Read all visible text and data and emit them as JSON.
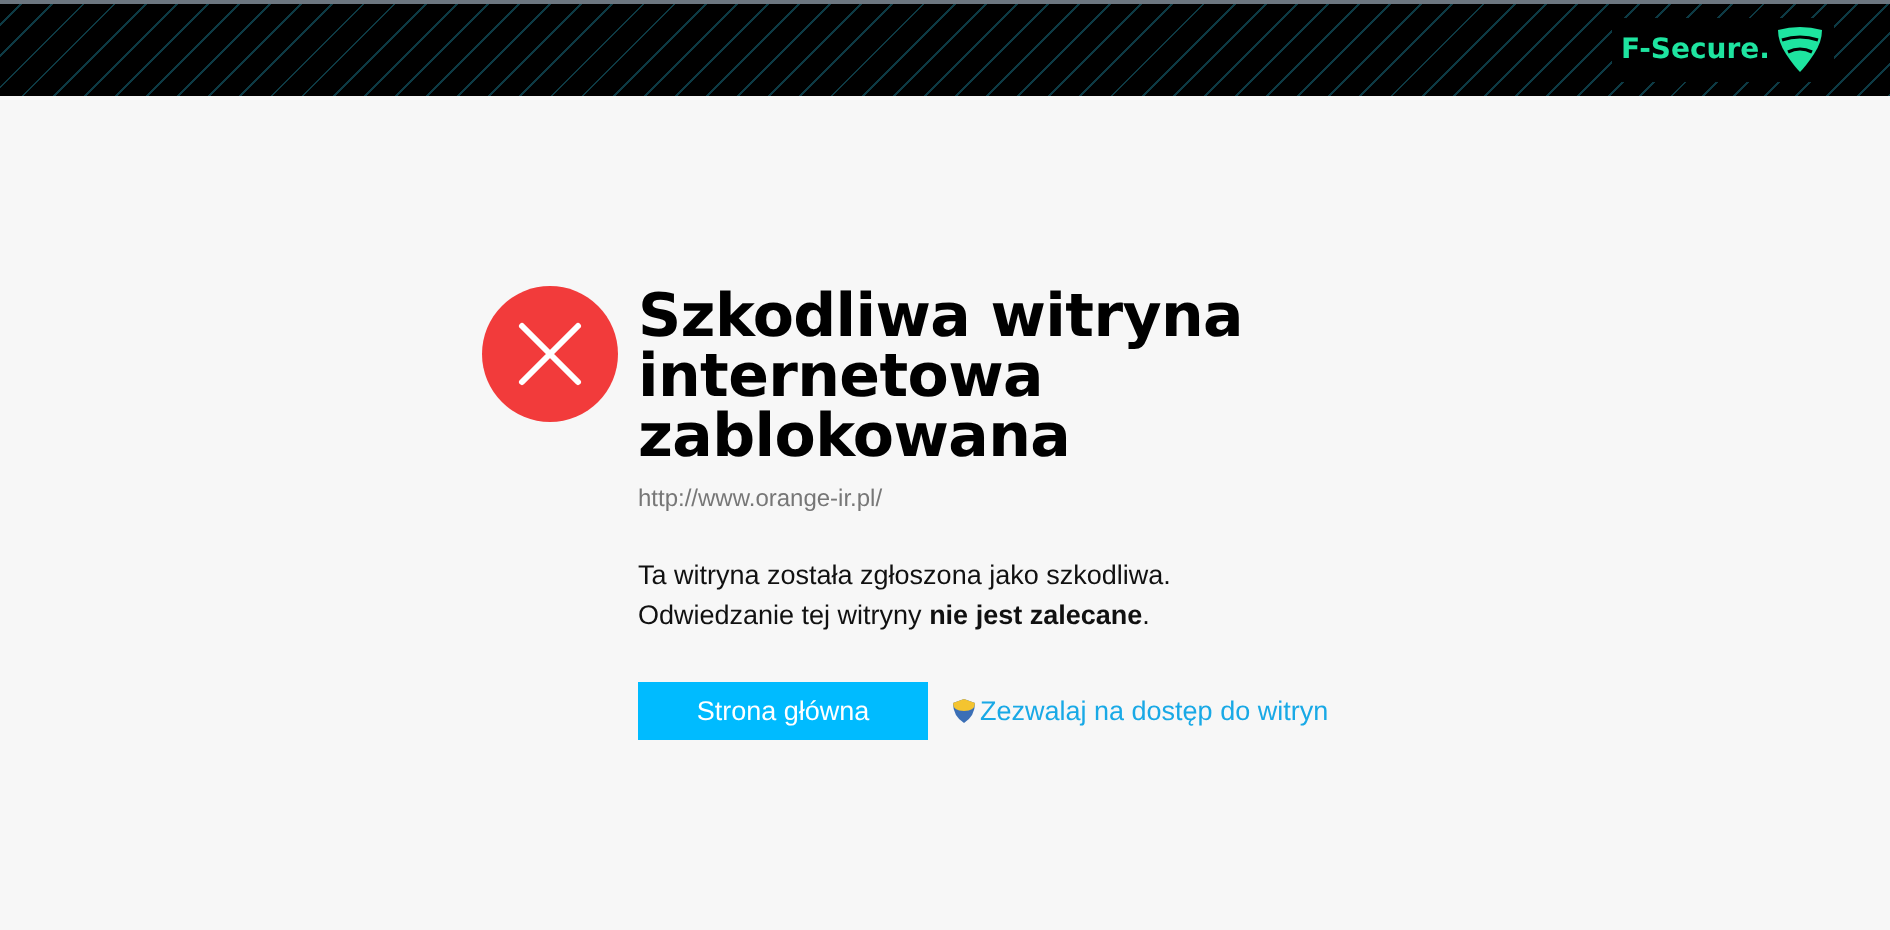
{
  "header": {
    "logo_text": "F-Secure."
  },
  "title": "Szkodliwa witryna internetowa zablokowana",
  "url": "http://www.orange-ir.pl/",
  "message": [
    "Ta witryna została zgłoszona jako szkodliwa.",
    "Odwiedzanie tej witryny **nie jest zalecane**."
  ],
  "buttons": {
    "primary": "Strona główna",
    "allow_link": "Zezwalaj na dostęp do witryn"
  }
}
